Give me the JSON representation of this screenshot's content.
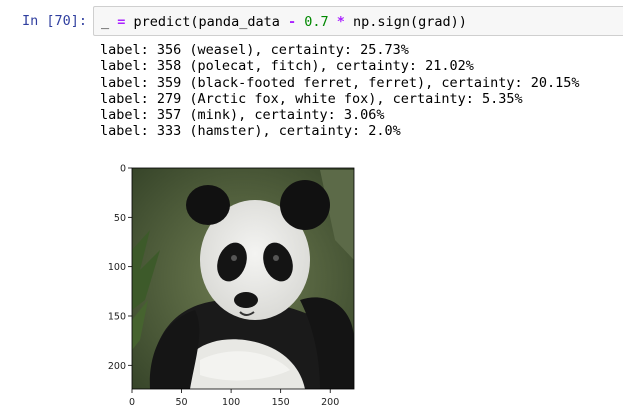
{
  "cell": {
    "prompt": "In [70]:",
    "code": {
      "underscore": "_ ",
      "assign": "= ",
      "call_open": "predict(panda_data ",
      "minus": "-",
      "space1": " ",
      "num": "0.7",
      "space2": " ",
      "star": "*",
      "rest": " np.sign(grad))"
    }
  },
  "output": {
    "lines": [
      "label: 356 (weasel), certainty: 25.73%",
      "label: 358 (polecat, fitch), certainty: 21.02%",
      "label: 359 (black-footed ferret, ferret), certainty: 20.15%",
      "label: 279 (Arctic fox, white fox), certainty: 5.35%",
      "label: 357 (mink), certainty: 3.06%",
      "label: 333 (hamster), certainty: 2.0%"
    ]
  },
  "figure": {
    "image_subject": "panda",
    "x_ticks": [
      "0",
      "50",
      "100",
      "150",
      "200"
    ],
    "y_ticks": [
      "0",
      "50",
      "100",
      "150",
      "200"
    ],
    "x_tick_values": [
      0,
      50,
      100,
      150,
      200
    ],
    "y_tick_values": [
      0,
      50,
      100,
      150,
      200
    ],
    "extent": 224
  }
}
